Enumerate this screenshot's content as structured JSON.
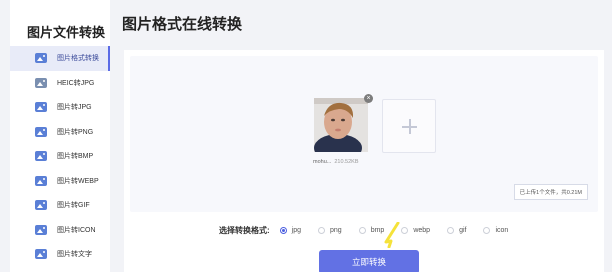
{
  "sidebar": {
    "title": "图片文件转换",
    "items": [
      {
        "label": "图片格式转换",
        "icon": "image-icon",
        "active": true
      },
      {
        "label": "HEIC转JPG",
        "icon": "heic-file-icon",
        "active": false
      },
      {
        "label": "图片转JPG",
        "icon": "image-icon",
        "active": false
      },
      {
        "label": "图片转PNG",
        "icon": "image-icon",
        "active": false
      },
      {
        "label": "图片转BMP",
        "icon": "image-icon",
        "active": false
      },
      {
        "label": "图片转WEBP",
        "icon": "image-icon",
        "active": false
      },
      {
        "label": "图片转GIF",
        "icon": "image-icon",
        "active": false
      },
      {
        "label": "图片转ICON",
        "icon": "image-icon",
        "active": false
      },
      {
        "label": "图片转文字",
        "icon": "image-icon",
        "active": false
      }
    ]
  },
  "page": {
    "title": "图片格式在线转换"
  },
  "upload": {
    "file_name": "mohu...",
    "file_size": "210.52KB",
    "remove_symbol": "×",
    "summary": "已上传1个文件，共0.21M"
  },
  "format": {
    "label": "选择转换格式:",
    "options": [
      "jpg",
      "png",
      "bmp",
      "webp",
      "gif",
      "icon"
    ],
    "selected": "jpg"
  },
  "action": {
    "convert_label": "立即转换"
  },
  "colors": {
    "accent": "#6271e4",
    "selected_radio": "#4c5fe0",
    "pointer": "#f5e23a"
  }
}
